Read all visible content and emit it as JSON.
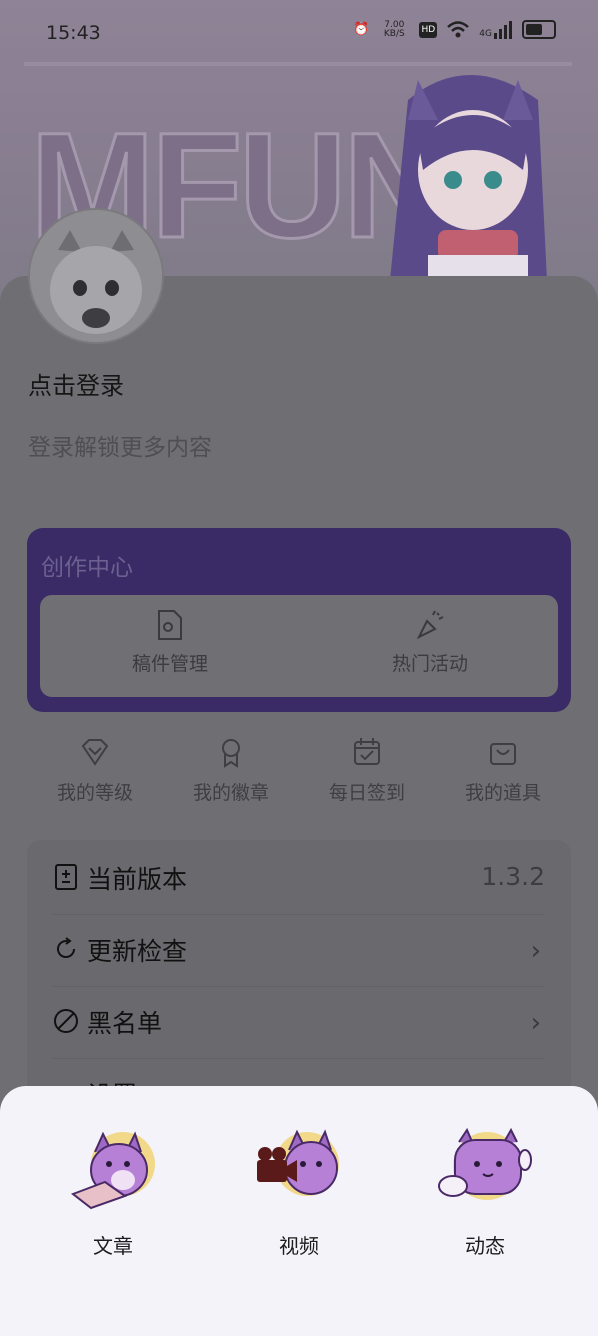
{
  "status_bar": {
    "time": "15:43",
    "net_speed": "7.00 KB/S",
    "hd": "HD",
    "signal": "4G"
  },
  "banner": {
    "logo_text": "MFUN"
  },
  "profile": {
    "login_title": "点击登录",
    "login_subtitle": "登录解锁更多内容"
  },
  "creation_center": {
    "title": "创作中心",
    "items": [
      {
        "label": "稿件管理",
        "icon": "document-gear-icon"
      },
      {
        "label": "热门活动",
        "icon": "party-popper-icon"
      }
    ]
  },
  "quick_actions": [
    {
      "label": "我的等级",
      "icon": "diamond-icon"
    },
    {
      "label": "我的徽章",
      "icon": "badge-icon"
    },
    {
      "label": "每日签到",
      "icon": "calendar-check-icon"
    },
    {
      "label": "我的道具",
      "icon": "bag-icon"
    }
  ],
  "settings": [
    {
      "label": "当前版本",
      "value": "1.3.2",
      "icon": "version-icon"
    },
    {
      "label": "更新检查",
      "icon": "refresh-icon"
    },
    {
      "label": "黑名单",
      "icon": "block-icon"
    },
    {
      "label": "设置",
      "icon": "gear-icon"
    }
  ],
  "publish_sheet": {
    "options": [
      {
        "label": "文章",
        "icon": "cat-article-icon"
      },
      {
        "label": "视频",
        "icon": "cat-video-icon"
      },
      {
        "label": "动态",
        "icon": "cat-post-icon"
      }
    ]
  },
  "colors": {
    "creation_bg": "#3a2b66",
    "sheet_bg": "#f3f3f9",
    "dim_overlay": "#6f6f73"
  }
}
